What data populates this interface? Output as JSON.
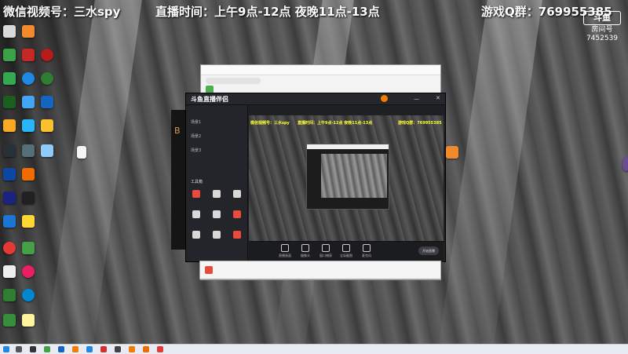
{
  "overlay": {
    "wechat": "微信视频号：三水spy",
    "schedule": "直播时间：上午9点-12点 夜晚11点-13点",
    "qq_group": "游戏Q群：769955385"
  },
  "watermark": {
    "logo": "斗鱼",
    "label": "房间号",
    "room_id": "7452539"
  },
  "app": {
    "brand": "斗鱼直播伴侣",
    "sidebar_rows": [
      "场景1",
      "场景2",
      "场景3"
    ],
    "tools_title": "工具箱",
    "tool_colors": [
      "#e84a3c",
      "#d8d8d8",
      "#d8d8d8",
      "#e84a3c",
      "#d8d8d8",
      "#e84a3c",
      "#d8d8d8",
      "#d8d8d8",
      "#e84a3c"
    ],
    "controls": [
      "直播画面",
      "摄像头",
      "窗口捕获",
      "全局截图",
      "麦克风"
    ],
    "go_live": "开始直播"
  },
  "side_strip": "B",
  "colors": {
    "overlay_text": "#ffffff",
    "accent_red": "#e84a3c",
    "overlay_preview": "#ffff33"
  }
}
